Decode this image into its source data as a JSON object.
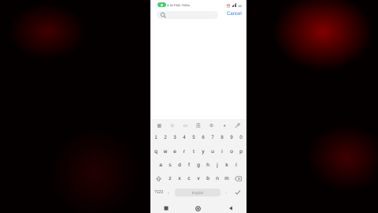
{
  "status_bar": {
    "time": "4:16 PM",
    "net_speed": "2.7KB/s",
    "right_text": "82"
  },
  "search": {
    "placeholder": "",
    "cancel_label": "Cancel"
  },
  "keyboard": {
    "toolbar_icons": [
      "grid-icon",
      "sticker-icon",
      "gif-icon",
      "clipboard-icon",
      "settings-icon",
      "palette-icon",
      "mic-icon"
    ],
    "number_row": [
      "1",
      "2",
      "3",
      "4",
      "5",
      "6",
      "7",
      "8",
      "9",
      "0"
    ],
    "row1": [
      "q",
      "w",
      "e",
      "r",
      "t",
      "y",
      "u",
      "i",
      "o",
      "p"
    ],
    "row2": [
      "a",
      "s",
      "d",
      "f",
      "g",
      "h",
      "j",
      "k",
      "l"
    ],
    "row3": [
      "z",
      "x",
      "c",
      "v",
      "b",
      "n",
      "m"
    ],
    "mode_key": "?123",
    "comma": ",",
    "space_label": "English",
    "period": "."
  },
  "colors": {
    "accent": "#2f7de1",
    "recording_pill": "#3ccf6e"
  }
}
